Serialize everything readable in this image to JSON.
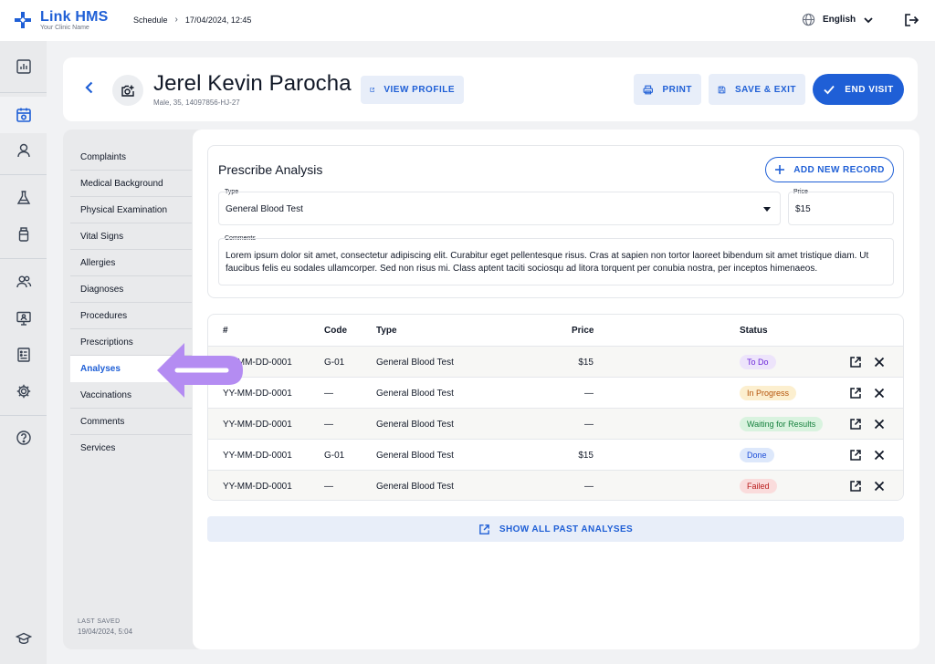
{
  "app": {
    "name": "Link HMS",
    "subtitle": "Your Clinic Name"
  },
  "breadcrumb": {
    "section": "Schedule",
    "separator": "›",
    "datetime": "17/04/2024, 12:45"
  },
  "language": {
    "selected": "English"
  },
  "patient": {
    "name": "Jerel Kevin Parocha",
    "meta": "Male, 35, 14097856-HJ-27"
  },
  "header_actions": {
    "view_profile": "VIEW PROFILE",
    "print": "PRINT",
    "save_exit": "SAVE & EXIT",
    "end_visit": "END VISIT"
  },
  "sections": [
    {
      "label": "Complaints"
    },
    {
      "label": "Medical Background"
    },
    {
      "label": "Physical Examination"
    },
    {
      "label": "Vital Signs"
    },
    {
      "label": "Allergies"
    },
    {
      "label": "Diagnoses"
    },
    {
      "label": "Procedures"
    },
    {
      "label": "Prescriptions"
    },
    {
      "label": "Analyses"
    },
    {
      "label": "Vaccinations"
    },
    {
      "label": "Comments"
    },
    {
      "label": "Services"
    }
  ],
  "active_section": "Analyses",
  "last_saved": {
    "label": "LAST SAVED",
    "value": "19/04/2024, 5:04"
  },
  "prescribe": {
    "title": "Prescribe Analysis",
    "add_button": "ADD NEW RECORD",
    "type_label": "Type",
    "type_value": "General Blood Test",
    "price_label": "Price",
    "price_value": "$15",
    "comments_label": "Comments",
    "comments_value": "Lorem ipsum dolor sit amet, consectetur adipiscing elit. Curabitur eget pellentesque risus. Cras at sapien non tortor laoreet bibendum sit amet tristique diam. Ut faucibus felis eu sodales ullamcorper. Sed non risus mi. Class aptent taciti sociosqu ad litora torquent per conubia nostra, per inceptos himenaeos."
  },
  "table": {
    "columns": {
      "num": "#",
      "code": "Code",
      "type": "Type",
      "price": "Price",
      "status": "Status"
    },
    "rows": [
      {
        "num": "YY-MM-DD-0001",
        "code": "G-01",
        "type": "General Blood Test",
        "price": "$15",
        "status": "To Do",
        "status_color": "#6d28d9",
        "status_bg": "#ede4fb"
      },
      {
        "num": "YY-MM-DD-0001",
        "code": "—",
        "type": "General Blood Test",
        "price": "—",
        "status": "In Progress",
        "status_color": "#b45309",
        "status_bg": "#fcefcf"
      },
      {
        "num": "YY-MM-DD-0001",
        "code": "—",
        "type": "General Blood Test",
        "price": "—",
        "status": "Waiting for Results",
        "status_color": "#15803d",
        "status_bg": "#d9f3df"
      },
      {
        "num": "YY-MM-DD-0001",
        "code": "G-01",
        "type": "General Blood Test",
        "price": "$15",
        "status": "Done",
        "status_color": "#1d4ed8",
        "status_bg": "#dde8fb"
      },
      {
        "num": "YY-MM-DD-0001",
        "code": "—",
        "type": "General Blood Test",
        "price": "—",
        "status": "Failed",
        "status_color": "#b91c1c",
        "status_bg": "#fadcdc"
      }
    ]
  },
  "show_all": "SHOW ALL PAST ANALYSES",
  "colors": {
    "primary": "#1f5fd6",
    "soft": "#e8eef9",
    "pointer": "#b48cf2"
  },
  "icons": {
    "rail": [
      "chart-icon",
      "calendar-icon",
      "user-icon",
      "flask-icon",
      "bottle-icon",
      "users-icon",
      "monitor-icon",
      "report-icon",
      "gear-icon",
      "help-icon",
      "graduation-cap-icon"
    ]
  }
}
